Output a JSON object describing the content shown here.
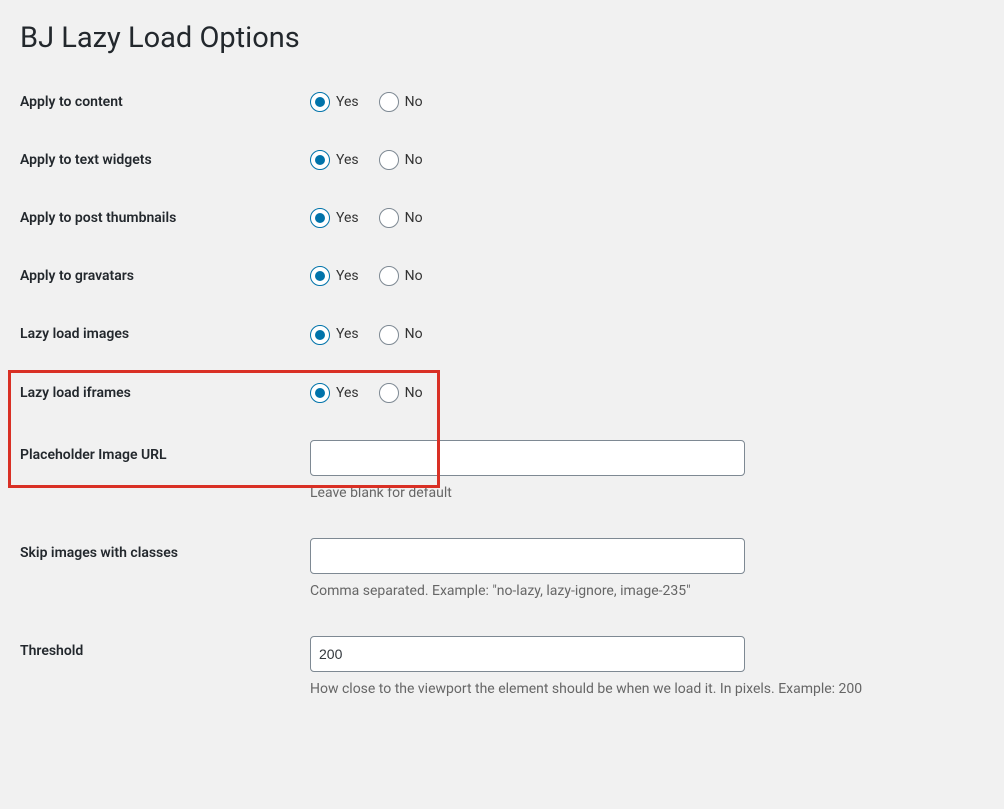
{
  "page": {
    "title": "BJ Lazy Load Options"
  },
  "options": {
    "apply_content": {
      "label": "Apply to content",
      "yes": "Yes",
      "no": "No",
      "value": "yes"
    },
    "apply_text_widgets": {
      "label": "Apply to text widgets",
      "yes": "Yes",
      "no": "No",
      "value": "yes"
    },
    "apply_post_thumbnails": {
      "label": "Apply to post thumbnails",
      "yes": "Yes",
      "no": "No",
      "value": "yes"
    },
    "apply_gravatars": {
      "label": "Apply to gravatars",
      "yes": "Yes",
      "no": "No",
      "value": "yes"
    },
    "lazy_images": {
      "label": "Lazy load images",
      "yes": "Yes",
      "no": "No",
      "value": "yes"
    },
    "lazy_iframes": {
      "label": "Lazy load iframes",
      "yes": "Yes",
      "no": "No",
      "value": "yes"
    },
    "placeholder_url": {
      "label": "Placeholder Image URL",
      "value": "",
      "description": "Leave blank for default"
    },
    "skip_classes": {
      "label": "Skip images with classes",
      "value": "",
      "description": "Comma separated. Example: \"no-lazy, lazy-ignore, image-235\""
    },
    "threshold": {
      "label": "Threshold",
      "value": "200",
      "description": "How close to the viewport the element should be when we load it. In pixels. Example: 200"
    }
  }
}
